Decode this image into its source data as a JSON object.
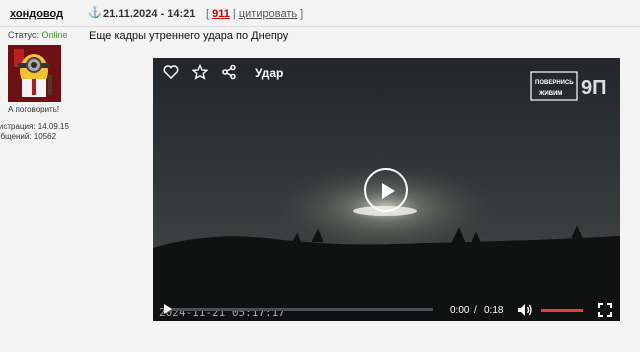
{
  "post": {
    "author": "хондовод",
    "date": "21.11.2024 - 14:21",
    "post_number": "911",
    "quote_label": "цитировать",
    "text": "Еще кадры утреннего удара по Днепру"
  },
  "user": {
    "status_label": "Статус:",
    "status_value": "Online",
    "talk_label": "А поговорить!",
    "reg_label": "гистрация: 14.09.15",
    "msgs_label": "общений: 10562"
  },
  "video": {
    "title": "Удар",
    "logo_text_1": "ПОВЕРНИСЬ",
    "logo_text_2": "ЖИВИМ",
    "logo_mark": "9П",
    "timestamp": "2024-11-21 05:17:17",
    "current_time": "0:00",
    "separator": "/",
    "duration": "0:18",
    "progress": 0,
    "volume": 1
  },
  "colors": {
    "online": "#3a9a2a",
    "post_number": "#cc0000",
    "volume": "#e0433f"
  }
}
